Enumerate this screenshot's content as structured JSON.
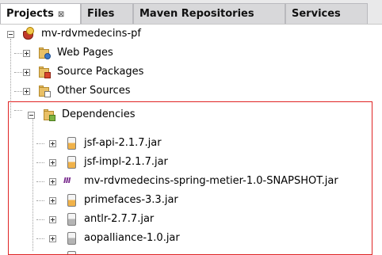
{
  "tabs": [
    {
      "label": "Projects",
      "close": "⊠",
      "active": true
    },
    {
      "label": "Files",
      "active": false
    },
    {
      "label": "Maven Repositories",
      "active": false
    },
    {
      "label": "Services",
      "active": false
    }
  ],
  "tree": {
    "root": {
      "label": "mv-rdvmedecins-pf",
      "expanded": true,
      "icon": "maven-project-icon"
    },
    "children": [
      {
        "label": "Web Pages",
        "icon": "web-pages-folder-icon",
        "expanded": false
      },
      {
        "label": "Source Packages",
        "icon": "source-packages-folder-icon",
        "expanded": false
      },
      {
        "label": "Other Sources",
        "icon": "other-sources-folder-icon",
        "expanded": false
      },
      {
        "label": "Dependencies",
        "icon": "dependencies-folder-icon",
        "expanded": true
      }
    ],
    "dependencies": [
      {
        "label": "jsf-api-2.1.7.jar",
        "icon": "jar-icon-orange"
      },
      {
        "label": "jsf-impl-2.1.7.jar",
        "icon": "jar-icon-orange"
      },
      {
        "label": "mv-rdvmedecins-spring-metier-1.0-SNAPSHOT.jar",
        "icon": "maven-module-icon"
      },
      {
        "label": "primefaces-3.3.jar",
        "icon": "jar-icon-orange"
      },
      {
        "label": "antlr-2.7.7.jar",
        "icon": "jar-icon-grey"
      },
      {
        "label": "aopalliance-1.0.jar",
        "icon": "jar-icon-grey"
      }
    ]
  },
  "highlight_color": "#e02424"
}
